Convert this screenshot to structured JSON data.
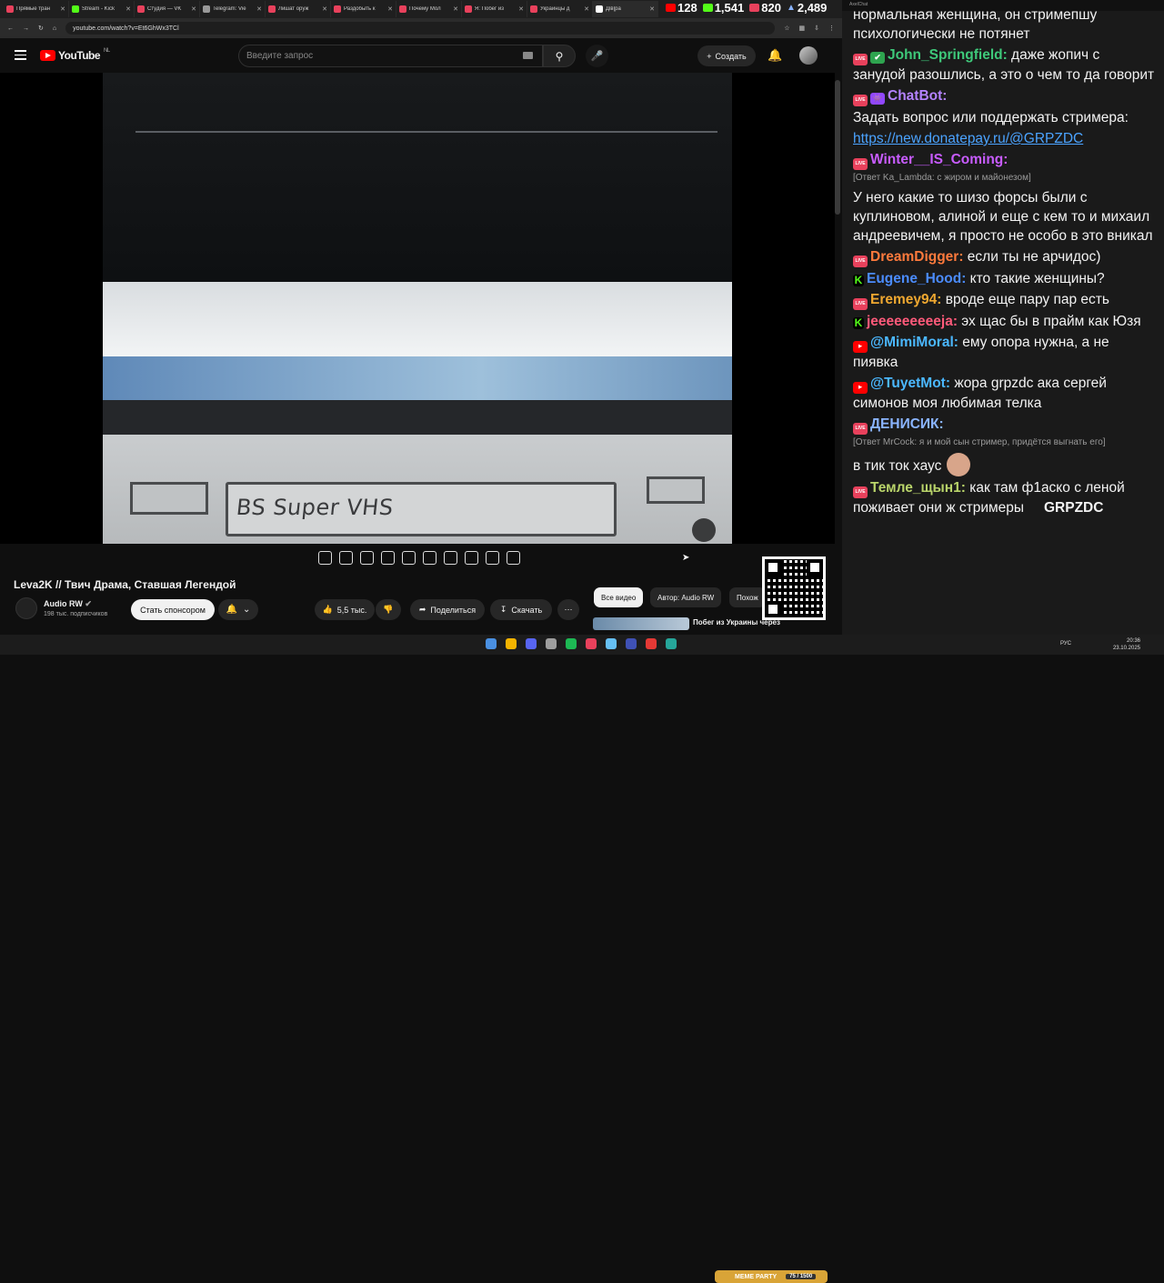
{
  "browser": {
    "tabs": [
      {
        "label": "Прямые тран",
        "color": "#e8415c"
      },
      {
        "label": "Stream - Kick",
        "color": "#53fc18"
      },
      {
        "label": "Студия — VK",
        "color": "#e8415c"
      },
      {
        "label": "Telegram: Vie",
        "color": "#999999"
      },
      {
        "label": "Лишат оруж",
        "color": "#e8415c"
      },
      {
        "label": "Раздобыть к",
        "color": "#e8415c"
      },
      {
        "label": "Почему Мол",
        "color": "#e8415c"
      },
      {
        "label": "Я: Побег из",
        "color": "#e8415c"
      },
      {
        "label": "Украинцы д",
        "color": "#e8415c"
      },
      {
        "label": "Дів|ра",
        "color": "#ffffff"
      }
    ],
    "url": "youtube.com/watch?v=Et6GhWx3TCl"
  },
  "stats": {
    "youtube": "128",
    "kick": "1,541",
    "vk": "820",
    "total": "2,489"
  },
  "youtube": {
    "logo": "YouTube",
    "region": "NL",
    "search_placeholder": "Введите запрос",
    "create_label": "Создать",
    "video_text": "BS Super VHS",
    "title": "Leva2K // Твич Драма, Ставшая Легендой",
    "channel": "Audio RW",
    "subscribers": "198 тыс. подписчиков",
    "sponsor_label": "Стать спонсором",
    "likes": "5,5 тыс.",
    "share_label": "Поделиться",
    "download_label": "Скачать",
    "chips": [
      "Все видео",
      "Автор: Audio RW",
      "Похож"
    ],
    "rec_title": "Побег из Украины через"
  },
  "chat": {
    "window_title": "AxelChat",
    "messages": [
      {
        "badge": "",
        "nick": "",
        "color": "",
        "text": "нормальная женщина, он стримепшу психологически не потянет"
      },
      {
        "badge": "live-check",
        "nick": "John_Springfield:",
        "color": "#3ec97a",
        "text": " даже жопич с занудой разошлись, а это о чем то да говорит"
      },
      {
        "badge": "live-bot",
        "nick": "ChatBot:",
        "color": "#b483ff",
        "text": ""
      },
      {
        "badge": "",
        "nick": "",
        "color": "",
        "text": "Задать вопрос или поддержать стримера:"
      },
      {
        "badge": "",
        "nick": "",
        "color": "",
        "text": "https://new.donatepay.ru/@GRPZDC"
      },
      {
        "badge": "live",
        "nick": "Winter__IS_Coming:",
        "color": "#c85cff",
        "text": ""
      },
      {
        "badge": "",
        "nick": "",
        "color": "",
        "text": "[Ответ Ka_Lambda: с жиром и майонезом]"
      },
      {
        "badge": "",
        "nick": "",
        "color": "",
        "text": "У него какие то шизо форсы были с куплиновом, алиной и еще с кем то и михаил андреевичем, я просто не особо в это вникал"
      },
      {
        "badge": "live",
        "nick": "DreamDigger:",
        "color": "#ff7a3c",
        "text": " если ты не арчидос)"
      },
      {
        "badge": "kick",
        "nick": "Eugene_Hood:",
        "color": "#4b8cff",
        "text": " кто такие женщины?"
      },
      {
        "badge": "live",
        "nick": "Eremey94:",
        "color": "#f0a830",
        "text": " вроде еще пару пар есть"
      },
      {
        "badge": "kick",
        "nick": "jeeeeeeeeeja:",
        "color": "#ff5a7a",
        "text": " эх щас бы в прайм как Юзя"
      },
      {
        "badge": "yt",
        "nick": "@MimiMoral:",
        "color": "#4bb8ff",
        "text": " ему опора нужна, а не пиявка"
      },
      {
        "badge": "yt",
        "nick": "@TuyetMot:",
        "color": "#4bb8ff",
        "text": " жора grpzdc ака сергей симонов моя любимая телка"
      },
      {
        "badge": "live",
        "nick": "ДЕНИСИК:",
        "color": "#8ab4ff",
        "text": ""
      },
      {
        "badge": "",
        "nick": "",
        "color": "",
        "text": "[Ответ MrCock: я и мой сын стример, придётся выгнать его]"
      },
      {
        "badge": "",
        "nick": "",
        "color": "",
        "text": "в тик ток хаус"
      },
      {
        "badge": "live",
        "nick": "Темле_щын1:",
        "color": "#b9d46a",
        "text": " как там ф1аско с леной поживает они ж стримеры"
      },
      {
        "badge": "",
        "nick": "",
        "color": "",
        "text": "GRPZDC"
      }
    ]
  },
  "taskbar": {
    "meme_label": "MEME PARTY",
    "meme_progress": "75 / 1500",
    "lang": "РУС",
    "time": "20:36",
    "date": "23.10.2025"
  }
}
